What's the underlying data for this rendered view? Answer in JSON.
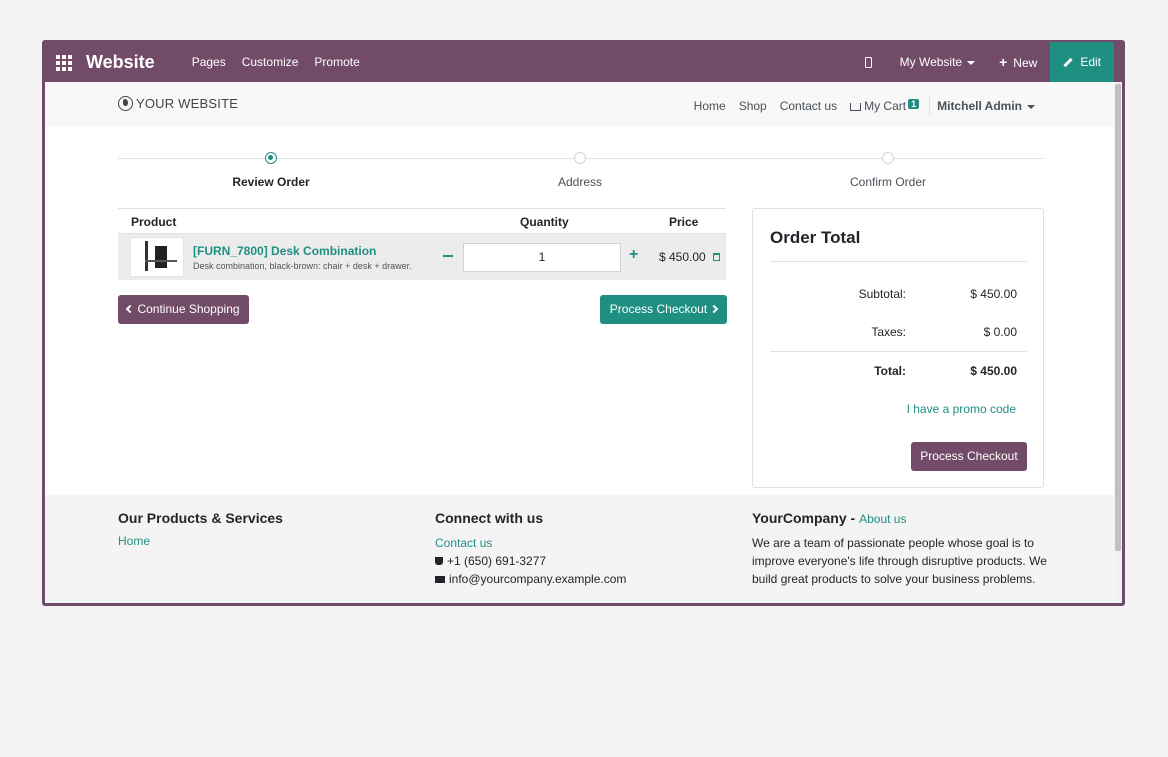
{
  "adminbar": {
    "brand": "Website",
    "menu": [
      "Pages",
      "Customize",
      "Promote"
    ],
    "my_website": "My Website",
    "new_label": "New",
    "edit_label": "Edit"
  },
  "header": {
    "logo_text": "YOUR WEBSITE",
    "nav": [
      "Home",
      "Shop",
      "Contact us"
    ],
    "cart_label": "My Cart",
    "cart_count": "1",
    "user": "Mitchell Admin"
  },
  "steps": [
    "Review Order",
    "Address",
    "Confirm Order"
  ],
  "cart": {
    "headers": {
      "product": "Product",
      "quantity": "Quantity",
      "price": "Price"
    },
    "item": {
      "name": "[FURN_7800] Desk Combination",
      "description": "Desk combination, black-brown: chair + desk + drawer.",
      "quantity": "1",
      "price": "$ 450.00"
    },
    "continue_label": "Continue Shopping",
    "process_label": "Process Checkout"
  },
  "order_total": {
    "title": "Order Total",
    "subtotal_label": "Subtotal:",
    "subtotal": "$ 450.00",
    "taxes_label": "Taxes:",
    "taxes": "$ 0.00",
    "total_label": "Total:",
    "total": "$ 450.00",
    "promo": "I have a promo code",
    "checkout": "Process Checkout"
  },
  "footer": {
    "col1_title": "Our Products & Services",
    "col1_link": "Home",
    "col2_title": "Connect with us",
    "col2_link": "Contact us",
    "phone": "+1 (650) 691-3277",
    "email": "info@yourcompany.example.com",
    "col3_title": "YourCompany",
    "col3_about": "About us",
    "col3_text_1": "We are a team of passionate people whose goal is to",
    "col3_text_2": "improve everyone's life through disruptive products. We",
    "col3_text_3": "build great products to solve your business problems."
  }
}
